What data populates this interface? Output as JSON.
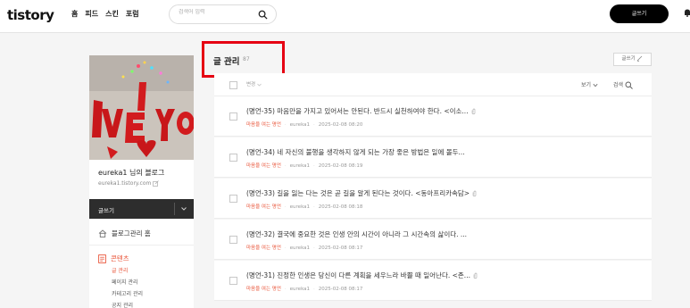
{
  "topbar": {
    "logo": "tistory",
    "nav": [
      "홈",
      "피드",
      "스킨",
      "포럼"
    ],
    "search_placeholder": "검색어 입력",
    "write_button": "글쓰기"
  },
  "sidebar": {
    "profile_image_text": "I VE YO",
    "blog_name": "eureka1 님의 블로그",
    "blog_url": "eureka1.tistory.com",
    "write_label": "글쓰기",
    "manage_home": "블로그관리 홈",
    "content_section": "콘텐츠",
    "content_items": [
      "글 관리",
      "페이지 관리",
      "카테고리 관리",
      "공지 관리"
    ]
  },
  "main": {
    "title": "글 관리",
    "count": "87",
    "write_small": "글쓰기",
    "header": {
      "change": "변경",
      "view": "보기",
      "search": "검색"
    },
    "posts": [
      {
        "title": "(명언-35) 마음만을 가지고 있어서는 안된다. 반드시 실천하여야 한다. <이소...",
        "category": "마음을 여는 명언",
        "author": "eureka1",
        "date": "2025-02-08 08:20",
        "attachment": true
      },
      {
        "title": "(명언-34) 네 자신의 불행을 생각하지 않게 되는 가장 좋은 방법은 일에 몰두...",
        "category": "마음을 여는 명언",
        "author": "eureka1",
        "date": "2025-02-08 08:19",
        "attachment": false
      },
      {
        "title": "(명언-33) 길을 잃는 다는 것은 곧 길을 알게 된다는 것이다. <동아프리카속담>",
        "category": "마음을 여는 명언",
        "author": "eureka1",
        "date": "2025-02-08 08:18",
        "attachment": true
      },
      {
        "title": "(명언-32) 결국에 중요한 것은 인생 안의 시간이 아니라 그 시간속의 삶이다. ...",
        "category": "마음을 여는 명언",
        "author": "eureka1",
        "date": "2025-02-08 08:17",
        "attachment": false
      },
      {
        "title": "(명언-31) 진정한 인생은 당신이 다른 계획을 세우느라 바쁠 때 일어난다. <존...",
        "category": "마음을 여는 명언",
        "author": "eureka1",
        "date": "2025-02-08 08:17",
        "attachment": true
      }
    ]
  },
  "colors": {
    "accent": "#e9553a",
    "highlight": "#e60012",
    "dark": "#000000"
  }
}
